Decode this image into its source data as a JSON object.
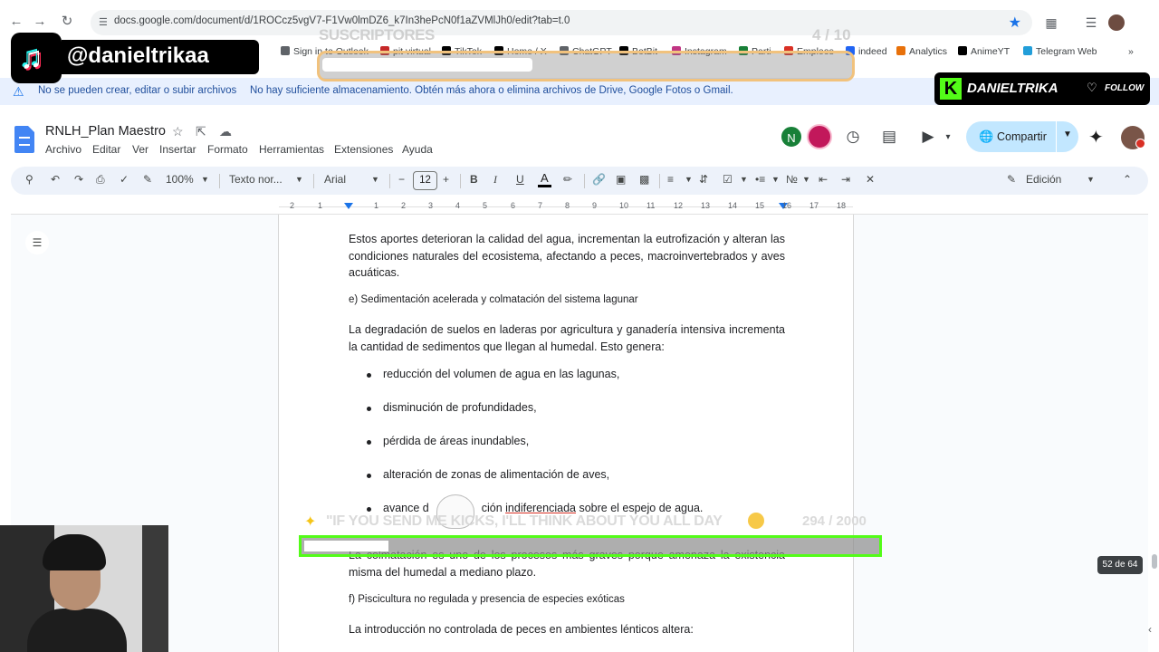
{
  "browser": {
    "url": "docs.google.com/document/d/1ROCcz5vgV7-F1Vw0lmDZ6_k7In3hePcN0f1aZVMlJh0/edit?tab=t.0",
    "bookmarks": [
      {
        "label": "Sign in to Outlook",
        "color": "#5f6368"
      },
      {
        "label": "pit virtual",
        "color": "#c62828"
      },
      {
        "label": "TikTok",
        "color": "#000000"
      },
      {
        "label": "Home / X",
        "color": "#000000"
      },
      {
        "label": "ChatGPT",
        "color": "#5f6368"
      },
      {
        "label": "BotBit",
        "color": "#000000"
      },
      {
        "label": "Instagram",
        "color": "#c13584"
      },
      {
        "label": "Parti",
        "color": "#188038"
      },
      {
        "label": "Empleos",
        "color": "#d93025"
      },
      {
        "label": "indeed",
        "color": "#2164f3"
      },
      {
        "label": "Analytics",
        "color": "#e8710a"
      },
      {
        "label": "AnimeYT",
        "color": "#000000"
      },
      {
        "label": "Telegram Web",
        "color": "#229ed9"
      }
    ]
  },
  "warning": {
    "title": "No se pueden crear, editar o subir archivos",
    "message": "No hay suficiente almacenamiento. Obtén más ahora o elimina archivos de Drive, Google Fotos o Gmail."
  },
  "doc": {
    "title": "RNLH_Plan Maestro",
    "menu": [
      "Archivo",
      "Editar",
      "Ver",
      "Insertar",
      "Formato",
      "Herramientas",
      "Extensiones",
      "Ayuda"
    ],
    "share_label": "Compartir",
    "avatar_initial": "N"
  },
  "toolbar": {
    "zoom": "100%",
    "style": "Texto nor...",
    "font": "Arial",
    "font_size": "12",
    "mode": "Edición"
  },
  "ruler": {
    "ticks": [
      "2",
      "1",
      "1",
      "2",
      "3",
      "4",
      "5",
      "6",
      "7",
      "8",
      "9",
      "10",
      "11",
      "12",
      "13",
      "14",
      "15",
      "16",
      "17",
      "18"
    ]
  },
  "content": {
    "p1": "Estos aportes deterioran la calidad del agua, incrementan la eutrofización y alteran las condiciones naturales del ecosistema, afectando a peces, macroinvertebrados y aves acuáticas.",
    "h_e": "e) Sedimentación acelerada y colmatación del sistema lagunar",
    "p2": "La degradación de suelos en laderas por agricultura y ganadería intensiva incrementa la cantidad de sedimentos que llegan al humedal. Esto genera:",
    "bullets": [
      "reducción del volumen de agua en las lagunas,",
      "disminución de profundidades,",
      "pérdida de áreas inundables,",
      "alteración de zonas de alimentación de aves,"
    ],
    "bullet5_a": "avance d",
    "bullet5_b": "ción ",
    "bullet5_c": "indiferenciada",
    "bullet5_d": " sobre el espejo de agua.",
    "p3": "La colmatación es uno de los procesos más graves porque amenaza la existencia misma del humedal a mediano plazo.",
    "h_f": "f) Piscicultura no regulada y presencia de especies exóticas",
    "p4": "La introducción no controlada de peces en ambientes lénticos altera:",
    "page_counter": "52 de 64"
  },
  "overlay": {
    "tiktok_handle": "@danieltrikaa",
    "sub_goal_title": "SUSCRIPTORES",
    "sub_goal_count": "4 / 10",
    "sub_goal_progress": 0.4,
    "kick_name": "DANIELTRIKA",
    "kick_follow": "FOLLOW",
    "kick_goal_text": "\"IF YOU SEND ME KICKS, I'LL THINK ABOUT YOU ALL DAY",
    "kick_goal_count": "294 / 2000",
    "kick_goal_progress": 0.147,
    "colors": {
      "kick_green": "#53fc18",
      "docs_blue": "#4285f4",
      "share_bg": "#c2e7ff",
      "toolbar_bg": "#edf2fa"
    }
  }
}
